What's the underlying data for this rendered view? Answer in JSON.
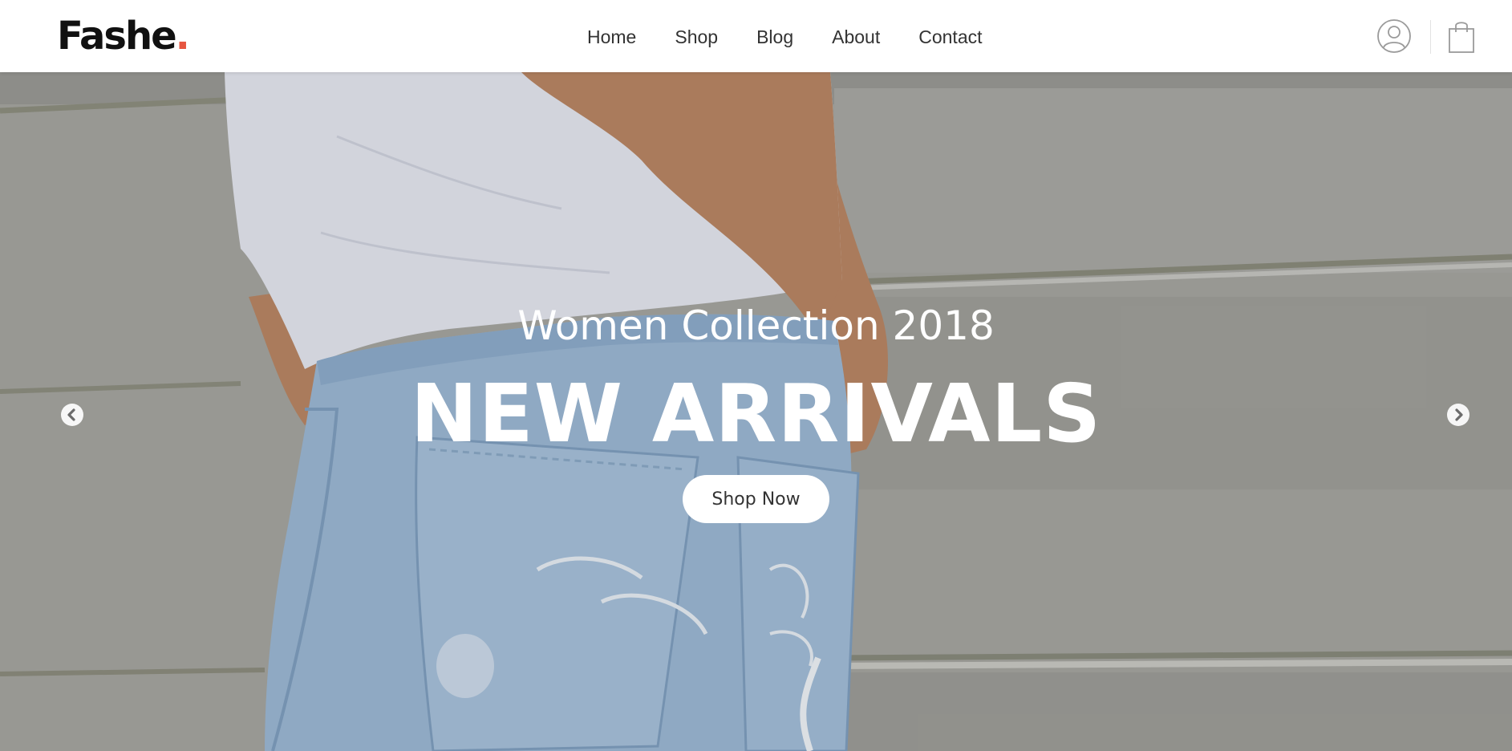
{
  "header": {
    "logo": {
      "text": "Fashe",
      "dot": "."
    },
    "nav": [
      "Home",
      "Shop",
      "Blog",
      "About",
      "Contact"
    ],
    "icons": {
      "account": "account-circle-icon",
      "cart": "shopping-bag-icon"
    }
  },
  "hero": {
    "subtitle": "Women Collection 2018",
    "title": "NEW ARRIVALS",
    "button": "Shop Now",
    "arrows": {
      "prev": "chevron-left-icon",
      "next": "chevron-right-icon"
    }
  },
  "colors": {
    "accent": "#e65540",
    "text_dark": "#111111",
    "nav_text": "#333333",
    "hero_text": "#ffffff",
    "hero_background": "#a4a4a0",
    "denim": "#9cb8d4",
    "shirt": "#e4e6ef",
    "skin": "#b98664"
  }
}
